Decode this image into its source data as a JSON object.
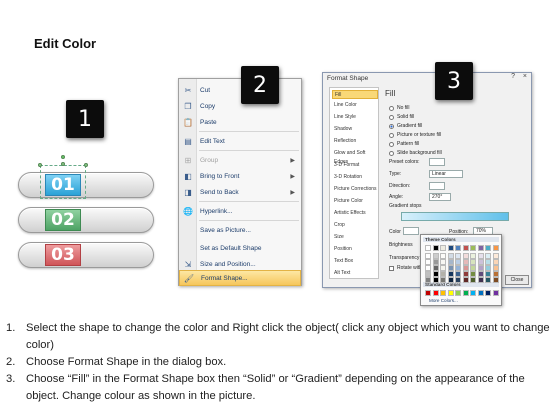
{
  "title": "Edit Color",
  "badges": [
    "1",
    "2",
    "3"
  ],
  "shapes": [
    "01",
    "02",
    "03"
  ],
  "context_menu": {
    "items": [
      {
        "label": "Cut",
        "icon": "scissors-icon"
      },
      {
        "label": "Copy",
        "icon": "copy-icon"
      },
      {
        "label": "Paste",
        "icon": "paste-icon"
      },
      {
        "label": "Edit Text",
        "icon": "edit-text-icon"
      },
      {
        "label": "Group",
        "icon": "group-icon",
        "disabled": true,
        "submenu": true
      },
      {
        "label": "Bring to Front",
        "icon": "bring-front-icon",
        "submenu": true
      },
      {
        "label": "Send to Back",
        "icon": "send-back-icon",
        "submenu": true
      },
      {
        "label": "Hyperlink...",
        "icon": "hyperlink-icon"
      },
      {
        "label": "Save as Picture...",
        "icon": ""
      },
      {
        "label": "Set as Default Shape",
        "icon": ""
      },
      {
        "label": "Size and Position...",
        "icon": "size-icon"
      },
      {
        "label": "Format Shape...",
        "icon": "format-shape-icon",
        "highlighted": true
      }
    ]
  },
  "format_dialog": {
    "title": "Format Shape",
    "close_glyph": "×",
    "help_glyph": "?",
    "nav": [
      "Fill",
      "Line Color",
      "Line Style",
      "Shadow",
      "Reflection",
      "Glow and Soft Edges",
      "3-D Format",
      "3-D Rotation",
      "Picture Corrections",
      "Picture Color",
      "Artistic Effects",
      "Crop",
      "Size",
      "Position",
      "Text Box",
      "Alt Text"
    ],
    "fill_heading": "Fill",
    "options": [
      "No fill",
      "Solid fill",
      "Gradient fill",
      "Picture or texture fill",
      "Pattern fill",
      "Slide background fill"
    ],
    "selected_option": "Gradient fill",
    "preset_label": "Preset colors:",
    "type_label": "Type:",
    "type_value": "Linear",
    "direction_label": "Direction:",
    "angle_label": "Angle:",
    "angle_value": "270°",
    "stops_label": "Gradient stops",
    "color_label": "Color",
    "position_label": "Position:",
    "position_value": "70%",
    "brightness_label": "Brightness",
    "transparency_label": "Transparency",
    "rotate_label": "Rotate with shape",
    "close_button": "Close"
  },
  "color_popup": {
    "theme_header": "Theme Colors",
    "standard_header": "Standard Colors",
    "more_colors": "More Colors...",
    "theme_colors": [
      "#ffffff",
      "#000000",
      "#eeece1",
      "#1f497d",
      "#4f81bd",
      "#c0504d",
      "#9bbb59",
      "#8064a2",
      "#4bacc6",
      "#f79646"
    ],
    "standard_colors": [
      "#c00000",
      "#ff0000",
      "#ffc000",
      "#ffff00",
      "#92d050",
      "#00b050",
      "#00b0f0",
      "#0070c0",
      "#002060",
      "#7030a0"
    ]
  },
  "steps": [
    {
      "num": "1.",
      "text": "Select the shape to change the color and Right click the object( click any object which you want to change color)"
    },
    {
      "num": "2.",
      "text": "Choose Format Shape in the dialog box."
    },
    {
      "num": "3.",
      "text": "Choose “Fill” in the Format Shape box then “Solid” or “Gradient” depending on the appearance of the object. Change colour as shown in the picture."
    }
  ]
}
